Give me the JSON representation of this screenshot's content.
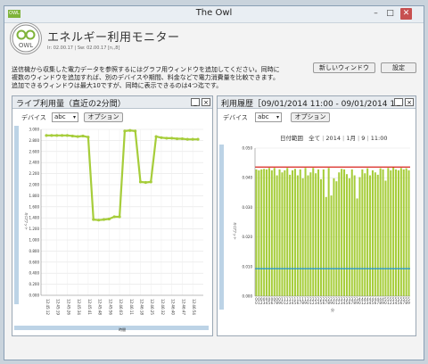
{
  "window": {
    "title": "The Owl",
    "icon_text": "OWL",
    "buttons": [
      "minimize-icon",
      "maximize-icon",
      "close-icon"
    ],
    "close_color": "#c75050"
  },
  "app": {
    "name": "エネルギー利用モニター",
    "version": "Ir: 02.00.17 | Sw: 02.00.17 [n,,8]",
    "logo_text": "OWL"
  },
  "description": {
    "line1": "送信機から収集した電力データを参照するにはグラフ用ウィンドウを追加してください。同時に",
    "line2": "複数のウィンドウを追加すれば、別のデバイスや期間、料金などで電力消費量を比較できます。",
    "line3": "追加できるウィンドウは最大10ですが、同時に表示できるのは4つ迄です。"
  },
  "toolbar": {
    "new_window_label": "新しいウィンドウ",
    "settings_label": "設定"
  },
  "live_panel": {
    "title": "ライブ利用量（直近の2分間）",
    "device_label": "デバイス",
    "device_value": "abc",
    "options_label": "オプション",
    "minimize_glyph": "_",
    "close_glyph": "×"
  },
  "history_panel": {
    "title": "利用履歴［09/01/2014 11:00 - 09/01/2014 11",
    "device_label": "デバイス",
    "device_value": "abc",
    "options_label": "オプション",
    "date_range_label": "日付範囲",
    "date_range_all": "全て",
    "year": "2014",
    "month": "1月",
    "day": "9",
    "time": "11:00",
    "minimize_glyph": "_",
    "close_glyph": "×"
  },
  "colors": {
    "series": "#a6cd3a",
    "max_line": "#d9221c",
    "min_line": "#1a8fd6",
    "scrollbar": "#bcd3e6"
  },
  "chart_data": [
    {
      "type": "line",
      "title": "ライブ利用量（直近の2分間）",
      "xlabel": "時間",
      "ylabel": "キロワット",
      "ylim": [
        0,
        3.0
      ],
      "yticks": [
        "0.000",
        "0.200",
        "0.400",
        "0.600",
        "0.800",
        "1.000",
        "1.200",
        "1.400",
        "1.600",
        "1.800",
        "2.000",
        "2.200",
        "2.400",
        "2.600",
        "2.800",
        "3.000"
      ],
      "x": [
        "12:45:12",
        "12:45:16",
        "12:45:19",
        "12:45:23",
        "12:45:26",
        "12:45:30",
        "12:45:34",
        "12:45:37",
        "12:45:41",
        "12:45:45",
        "12:45:48",
        "12:45:52",
        "12:45:56",
        "12:45:59",
        "12:46:03",
        "12:46:07",
        "12:46:11",
        "12:46:14",
        "12:46:18",
        "12:46:21",
        "12:46:25",
        "12:46:29",
        "12:46:32",
        "12:46:36",
        "12:46:40",
        "12:46:43",
        "12:46:47",
        "12:46:51",
        "12:46:54",
        "12:46:58"
      ],
      "xtick_labels": [
        "12:45:12",
        "12:45:19",
        "12:45:26",
        "12:45:34",
        "12:45:41",
        "12:45:48",
        "12:45:56",
        "12:46:03",
        "12:46:11",
        "12:46:18",
        "12:46:25",
        "12:46:32",
        "12:46:40",
        "12:46:47",
        "12:46:54"
      ],
      "values": [
        2.89,
        2.89,
        2.89,
        2.89,
        2.89,
        2.88,
        2.87,
        2.88,
        2.86,
        1.37,
        1.36,
        1.37,
        1.38,
        1.42,
        1.42,
        2.97,
        2.98,
        2.97,
        2.05,
        2.04,
        2.05,
        2.87,
        2.85,
        2.84,
        2.84,
        2.83,
        2.83,
        2.82,
        2.82,
        2.82
      ]
    },
    {
      "type": "bar",
      "title": "利用履歴［09/01/2014 11:00 - 09/01/2014 11",
      "xlabel": "分",
      "ylabel": "キロワット",
      "ylim": [
        0,
        0.05
      ],
      "yticks": [
        "0.000",
        "0.010",
        "0.020",
        "0.030",
        "0.040",
        "0.050"
      ],
      "categories": [
        "00",
        "01",
        "02",
        "03",
        "04",
        "05",
        "06",
        "07",
        "08",
        "09",
        "10",
        "11",
        "12",
        "13",
        "14",
        "15",
        "16",
        "17",
        "18",
        "19",
        "20",
        "21",
        "22",
        "23",
        "24",
        "25",
        "26",
        "27",
        "28",
        "29",
        "30",
        "31",
        "32",
        "33",
        "34",
        "35",
        "36",
        "37",
        "38",
        "39",
        "40",
        "41",
        "42",
        "43",
        "44",
        "45",
        "46",
        "47",
        "48",
        "49",
        "50",
        "51",
        "52",
        "53",
        "54",
        "55",
        "56",
        "57",
        "58",
        "59"
      ],
      "values": [
        0.0428,
        0.0425,
        0.0428,
        0.043,
        0.0428,
        0.0433,
        0.0425,
        0.0433,
        0.0408,
        0.0428,
        0.0418,
        0.0425,
        0.0433,
        0.041,
        0.0425,
        0.043,
        0.0408,
        0.0428,
        0.0398,
        0.0433,
        0.0408,
        0.0418,
        0.0433,
        0.0415,
        0.0428,
        0.0395,
        0.0428,
        0.0335,
        0.0433,
        0.034,
        0.0398,
        0.0388,
        0.0418,
        0.043,
        0.0428,
        0.0412,
        0.0398,
        0.0428,
        0.0408,
        0.033,
        0.0402,
        0.0428,
        0.0415,
        0.0432,
        0.0408,
        0.0425,
        0.0418,
        0.041,
        0.0432,
        0.0428,
        0.039,
        0.0433,
        0.0425,
        0.0436,
        0.0428,
        0.0425,
        0.0433,
        0.0428,
        0.0432,
        0.0425
      ],
      "max_line": 0.0436,
      "min_line": 0.0093
    }
  ]
}
